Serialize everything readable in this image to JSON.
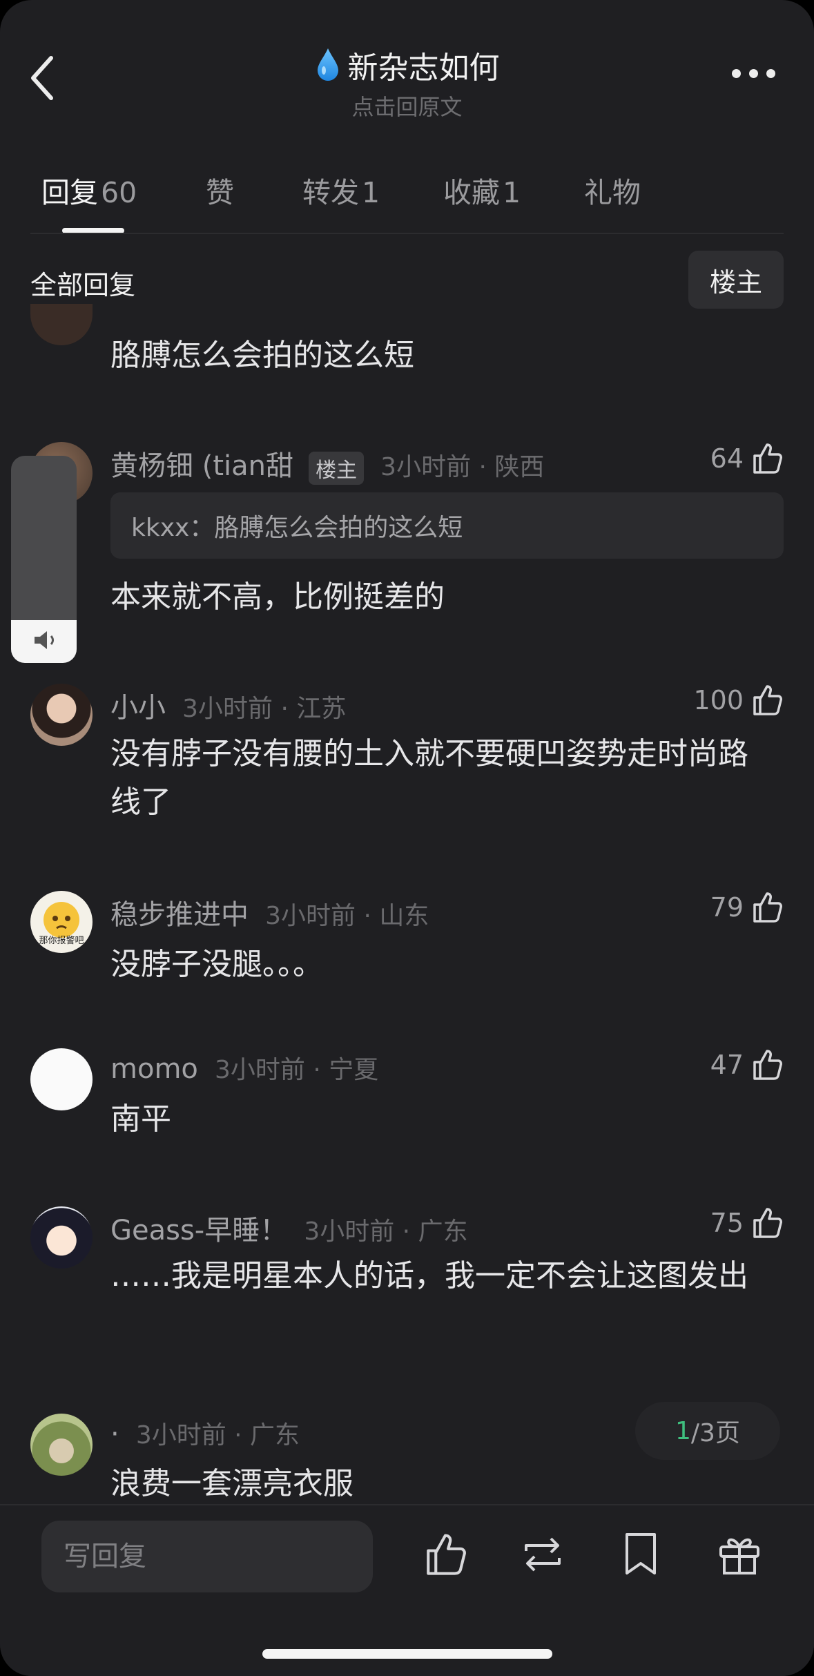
{
  "header": {
    "title": "新杂志如何",
    "subtitle": "点击回原文"
  },
  "tabs": [
    {
      "label": "回复",
      "count": "60"
    },
    {
      "label": "赞",
      "count": ""
    },
    {
      "label": "转发",
      "count": "1"
    },
    {
      "label": "收藏",
      "count": "1"
    },
    {
      "label": "礼物",
      "count": ""
    }
  ],
  "section": {
    "title": "全部回复",
    "filter_label": "楼主"
  },
  "comments": [
    {
      "name": "",
      "badge": "",
      "time": "",
      "likes": "",
      "text": "胳膊怎么会拍的这么短"
    },
    {
      "name": "黄杨钿 (tian甜",
      "badge": "楼主",
      "time": "3小时前 · 陕西",
      "likes": "64",
      "quote": "kkxx：胳膊怎么会拍的这么短",
      "text": "本来就不高，比例挺差的"
    },
    {
      "name": "小小",
      "time": "3小时前 · 江苏",
      "likes": "100",
      "text": "没有脖子没有腰的土入就不要硬凹姿势走时尚路线了"
    },
    {
      "name": "稳步推进中",
      "time": "3小时前 · 山东",
      "likes": "79",
      "text": "没脖子没腿。。。",
      "avatar_text": "那你报警吧"
    },
    {
      "name": "momo",
      "time": "3小时前 · 宁夏",
      "likes": "47",
      "text": "南平"
    },
    {
      "name": "Geass-早睡！",
      "time": "3小时前 · 广东",
      "likes": "75",
      "text": "……我是明星本人的话，我一定不会让这图发出"
    },
    {
      "name": "·",
      "time": "3小时前 · 广东",
      "likes": "",
      "text": "浪费一套漂亮衣服"
    }
  ],
  "pager": {
    "current": "1",
    "total": "/3页"
  },
  "bottom_bar": {
    "reply_placeholder": "写回复"
  },
  "icons": {
    "back": "chevron-left-icon",
    "more": "more-dots-icon",
    "title": "water-drop-icon",
    "like": "thumbs-up-icon",
    "repost": "repost-icon",
    "bookmark": "bookmark-icon",
    "gift": "gift-icon",
    "volume": "speaker-icon"
  },
  "colors": {
    "background": "#1f1f22",
    "accent_page": "#3fbf7f",
    "drop": "#3ba4f0"
  }
}
